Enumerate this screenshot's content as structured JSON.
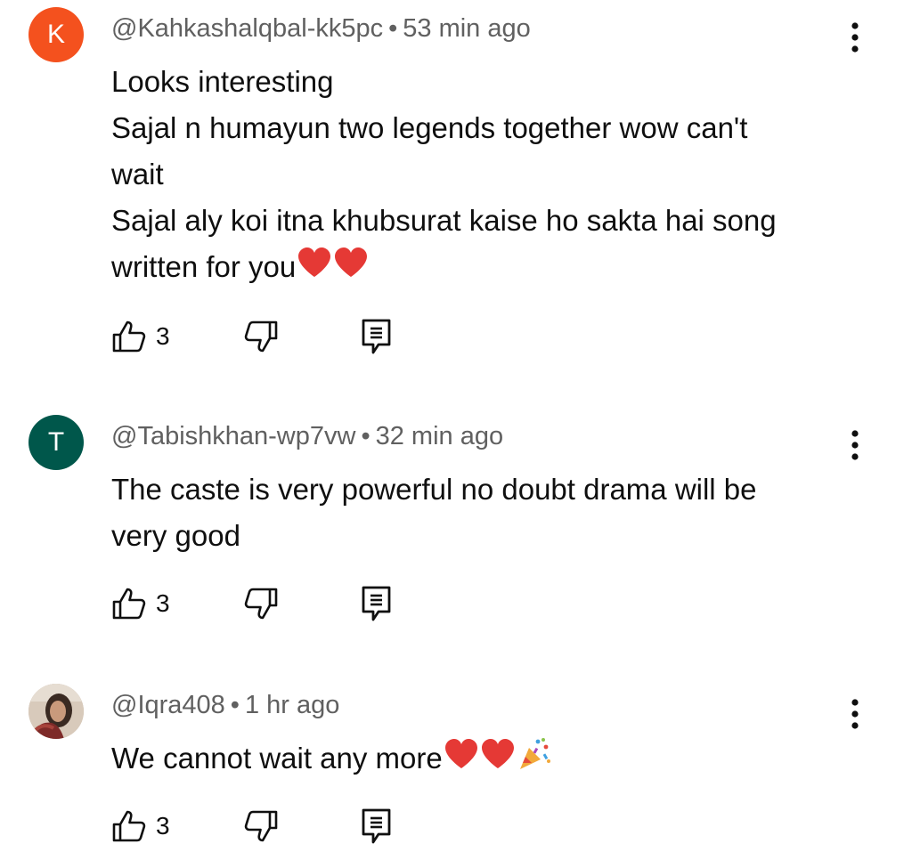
{
  "comments": [
    {
      "avatar_letter": "K",
      "avatar_color": "#f4511e",
      "author": "@Kahkashalqbal-kk5pc",
      "separator": "•",
      "time": "53 min ago",
      "lines": [
        "Looks interesting",
        "Sajal n humayun two legends together wow can't",
        "wait",
        "Sajal aly koi itna khubsurat kaise ho sakta hai  song",
        "written for you"
      ],
      "trailing_emoji": [
        "red-heart",
        "red-heart"
      ],
      "likes": "3",
      "menu_icon": "more-vert-icon"
    },
    {
      "avatar_letter": "T",
      "avatar_color": "#00574b",
      "author": "@Tabishkhan-wp7vw",
      "separator": "•",
      "time": "32 min ago",
      "lines": [
        "The caste is very powerful no doubt drama will be",
        "very good"
      ],
      "trailing_emoji": [],
      "likes": "3",
      "menu_icon": "more-vert-icon"
    },
    {
      "avatar_letter": "",
      "avatar_color": "#c9b8a6",
      "author": "@Iqra408",
      "separator": "•",
      "time": "1 hr ago",
      "lines": [
        "We cannot wait any more"
      ],
      "trailing_emoji": [
        "red-heart",
        "red-heart",
        "party-popper"
      ],
      "likes": "3",
      "menu_icon": "more-vert-icon"
    }
  ],
  "icons": {
    "like": "thumb-up-icon",
    "dislike": "thumb-down-icon",
    "reply": "reply-icon"
  }
}
